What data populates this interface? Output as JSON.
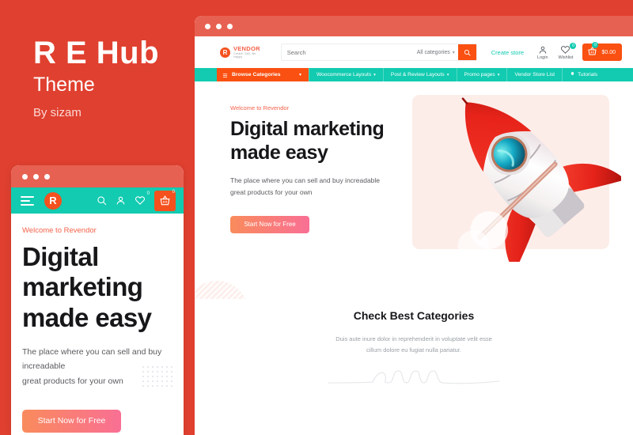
{
  "promo": {
    "title": "R E Hub",
    "subtitle": "Theme",
    "author": "By sizam",
    "bg_color": "#E0402F"
  },
  "colors": {
    "red_bg": "#E0402F",
    "titlebar": "#E76152",
    "teal": "#12CBB0",
    "orange": "#FA5011",
    "cta_gradient_from": "#F98B5C",
    "cta_gradient_to": "#F96F94",
    "hero_panel": "#FDEDE9"
  },
  "mobile": {
    "window_dots": [
      "dot",
      "dot",
      "dot"
    ],
    "nav": {
      "menu_icon": "hamburger-icon",
      "logo_letter": "R",
      "icons": [
        {
          "name": "search-icon",
          "badge": null
        },
        {
          "name": "user-icon",
          "badge": null
        },
        {
          "name": "wishlist-heart-icon",
          "badge": "0"
        },
        {
          "name": "cart-basket-icon",
          "badge": "0"
        }
      ]
    },
    "hero": {
      "eyebrow": "Welcome to Revendor",
      "heading": "Digital marketing made easy",
      "paragraph_line1": "The place where you can sell and buy increadable",
      "paragraph_line2": "great products for your own",
      "cta_label": "Start Now for Free"
    }
  },
  "desktop": {
    "window_dots": [
      "dot",
      "dot",
      "dot"
    ],
    "header": {
      "logo": {
        "mark": "R",
        "name": "VENDOR",
        "tagline": "Create. Sell. Be Happy"
      },
      "search": {
        "placeholder": "Search",
        "category_label": "All categories",
        "button_icon": "search-icon"
      },
      "create_store_label": "Create store",
      "account": [
        {
          "icon": "user-icon",
          "label": "Login",
          "badge": null
        },
        {
          "icon": "wishlist-heart-icon",
          "label": "Wishlist",
          "badge": "0"
        }
      ],
      "cart": {
        "icon": "cart-basket-icon",
        "badge": "0",
        "price": "$0.00"
      }
    },
    "nav": {
      "browse": {
        "icon": "list-icon",
        "label": "Browse Categories",
        "chevron": "chevron-down-icon"
      },
      "items": [
        {
          "label": "Woocommerce Layouts",
          "chevron": true,
          "icon": null
        },
        {
          "label": "Post & Review Layouts",
          "chevron": true,
          "icon": null
        },
        {
          "label": "Promo pages",
          "chevron": true,
          "icon": null
        },
        {
          "label": "Vendor Store List",
          "chevron": false,
          "icon": null
        },
        {
          "label": "Tutorials",
          "chevron": false,
          "icon": "gear-icon"
        }
      ]
    },
    "hero": {
      "eyebrow": "Welcome to Revendor",
      "heading": "Digital marketing made easy",
      "paragraph_line1": "The place where you can sell and buy increadable",
      "paragraph_line2": "great products for your own",
      "cta_label": "Start Now for Free",
      "image_name": "rocket-illustration"
    },
    "categories": {
      "title": "Check Best Categories",
      "subtitle_line1": "Duis aute inure dolor in reprehenderit in voluptate velit esse",
      "subtitle_line2": "cillum dolore eu fugiat nulla pariatur.",
      "divider_name": "squiggle-divider"
    }
  }
}
